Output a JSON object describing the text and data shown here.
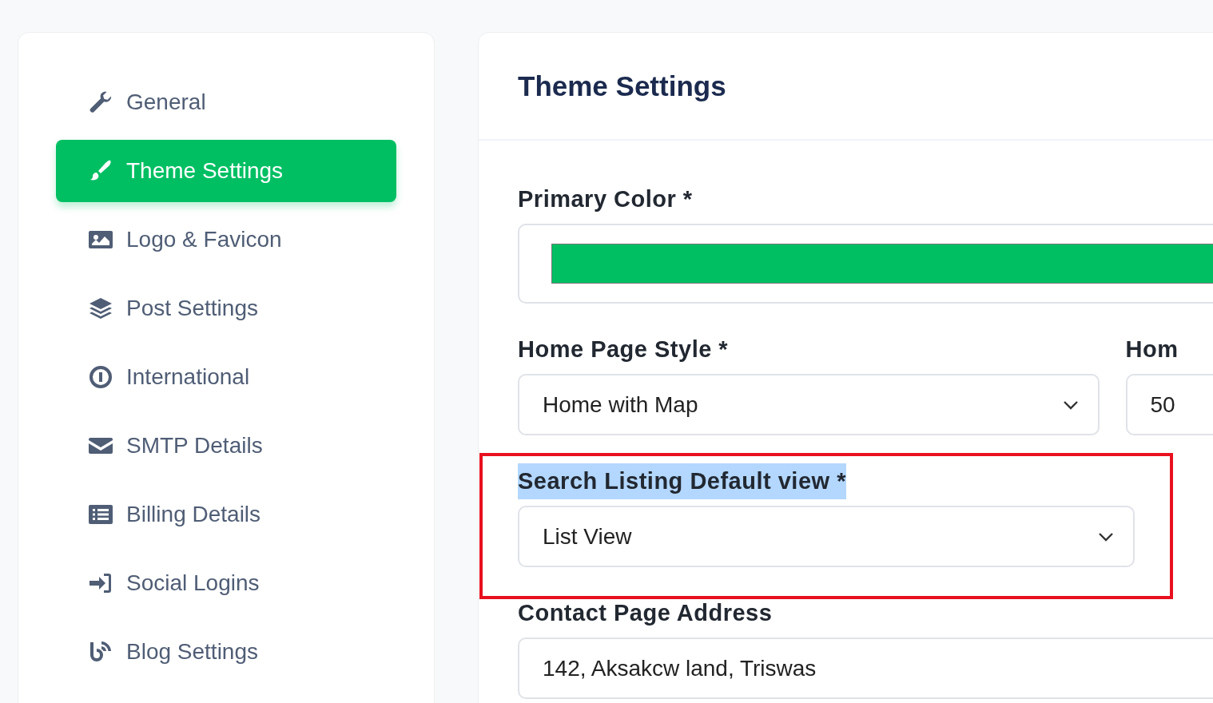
{
  "sidebar": {
    "items": [
      {
        "label": "General",
        "selected": false
      },
      {
        "label": "Theme Settings",
        "selected": true
      },
      {
        "label": "Logo & Favicon",
        "selected": false
      },
      {
        "label": "Post Settings",
        "selected": false
      },
      {
        "label": "International",
        "selected": false
      },
      {
        "label": "SMTP Details",
        "selected": false
      },
      {
        "label": "Billing Details",
        "selected": false
      },
      {
        "label": "Social Logins",
        "selected": false
      },
      {
        "label": "Blog Settings",
        "selected": false
      }
    ]
  },
  "panel": {
    "title": "Theme Settings",
    "rows": [
      {
        "fields": [
          {
            "kind": "color",
            "label": "Primary Color *",
            "color": "#00bf63"
          }
        ]
      },
      {
        "fields": [
          {
            "kind": "select",
            "label": "Home Page Style *",
            "value": "Home with Map"
          },
          {
            "kind": "input",
            "label": "Hom",
            "value": "50"
          }
        ]
      },
      {
        "fields": [
          {
            "kind": "select",
            "label": "Search Listing Default view *",
            "value": "List View",
            "highlighted": true,
            "label_selected": true
          }
        ]
      },
      {
        "fields": [
          {
            "kind": "input",
            "label": "Contact Page Address",
            "value": "142, Aksakcw land, Triswas"
          }
        ]
      }
    ]
  }
}
